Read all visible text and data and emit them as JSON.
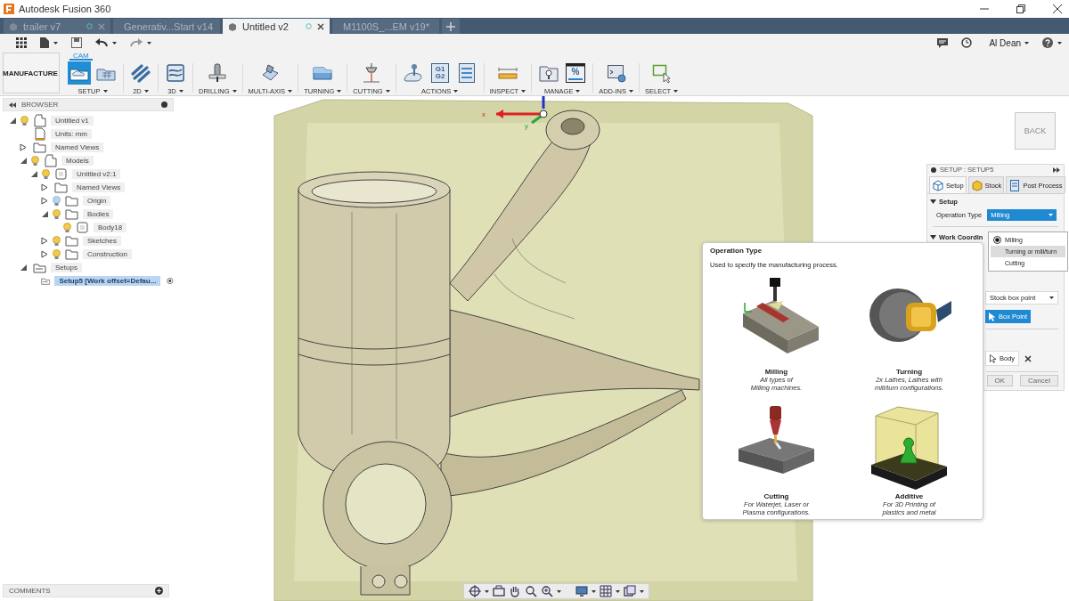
{
  "title_bar": {
    "app_title": "Autodesk Fusion 360"
  },
  "document_tabs": [
    {
      "label": "trailer v7",
      "selected": false
    },
    {
      "label": "Generativ...Start v14",
      "selected": false
    },
    {
      "label": "Untitled v2",
      "selected": true
    },
    {
      "label": "M1100S_...EM v19*",
      "selected": false
    }
  ],
  "user_menu": {
    "name": "Al Dean"
  },
  "ribbon": {
    "workspace": "MANUFACTURE",
    "tabs": [
      {
        "label": "CAM",
        "selected": true
      }
    ],
    "groups": [
      {
        "label": "SETUP",
        "tools": [
          {
            "kind": "setup",
            "selected": true
          },
          {
            "kind": "setup-sheet",
            "selected": false
          }
        ]
      },
      {
        "label": "2D",
        "tools": [
          {
            "kind": "pocket",
            "selected": false
          }
        ]
      },
      {
        "label": "3D",
        "tools": [
          {
            "kind": "surface",
            "selected": false
          }
        ]
      },
      {
        "label": "DRILLING",
        "tools": [
          {
            "kind": "drill",
            "selected": false
          }
        ]
      },
      {
        "label": "MULTI-AXIS",
        "tools": [
          {
            "kind": "multiaxis",
            "selected": false
          }
        ]
      },
      {
        "label": "TURNING",
        "tools": [
          {
            "kind": "turning",
            "selected": false
          }
        ]
      },
      {
        "label": "CUTTING",
        "tools": [
          {
            "kind": "cutting",
            "selected": false
          }
        ]
      },
      {
        "label": "ACTIONS",
        "tools": [
          {
            "kind": "simulate",
            "selected": false
          },
          {
            "kind": "gcode",
            "selected": false,
            "lines": [
              "G1",
              "G2"
            ]
          },
          {
            "kind": "sheet",
            "selected": false
          }
        ]
      },
      {
        "label": "INSPECT",
        "tools": [
          {
            "kind": "measure",
            "selected": false
          }
        ]
      },
      {
        "label": "MANAGE",
        "tools": [
          {
            "kind": "library",
            "selected": false
          },
          {
            "kind": "percent",
            "selected": false,
            "lines": [
              "%"
            ]
          }
        ]
      },
      {
        "label": "ADD-INS",
        "tools": [
          {
            "kind": "scripts",
            "selected": false
          }
        ]
      },
      {
        "label": "SELECT",
        "tools": [
          {
            "kind": "select",
            "selected": false
          }
        ]
      }
    ]
  },
  "browser": {
    "title": "BROWSER",
    "tree": [
      {
        "label": "Untitled v1",
        "kind": "component",
        "expanded": true,
        "visible": true,
        "selected": false,
        "children": [
          {
            "label": "Units: mm",
            "kind": "units",
            "selected": false
          },
          {
            "label": "Named Views",
            "kind": "folder",
            "expanded": false,
            "selected": false
          },
          {
            "label": "Models",
            "kind": "component",
            "expanded": true,
            "visible": true,
            "selected": false,
            "children": [
              {
                "label": "Untitled v2:1",
                "kind": "occurrence",
                "expanded": true,
                "visible": true,
                "selected": false,
                "children": [
                  {
                    "label": "Named Views",
                    "kind": "folder",
                    "expanded": false,
                    "selected": false
                  },
                  {
                    "label": "Origin",
                    "kind": "folder",
                    "expanded": false,
                    "visible": false,
                    "selected": false
                  },
                  {
                    "label": "Bodies",
                    "kind": "folder",
                    "expanded": true,
                    "visible": true,
                    "selected": false,
                    "children": [
                      {
                        "label": "Body18",
                        "kind": "body",
                        "visible": true,
                        "selected": false
                      }
                    ]
                  },
                  {
                    "label": "Sketches",
                    "kind": "folder",
                    "expanded": false,
                    "visible": true,
                    "selected": false
                  },
                  {
                    "label": "Construction",
                    "kind": "folder",
                    "expanded": false,
                    "visible": true,
                    "selected": false
                  }
                ]
              }
            ]
          },
          {
            "label": "Setups",
            "kind": "setups",
            "expanded": true,
            "selected": false,
            "children": [
              {
                "label": "Setup5 [Work offset=Defau...",
                "kind": "setup",
                "selected": true
              }
            ]
          }
        ]
      }
    ]
  },
  "viewport": {
    "view_cube": "BACK",
    "triad": {
      "x_label": "x",
      "y_label": "y"
    }
  },
  "setup_panel": {
    "title": "SETUP : SETUP5",
    "tabs": [
      {
        "label": "Setup",
        "kind": "setup",
        "selected": true
      },
      {
        "label": "Stock",
        "kind": "stock",
        "selected": false
      },
      {
        "label": "Post Process",
        "kind": "post",
        "selected": false
      }
    ],
    "section": {
      "label": "Setup",
      "expanded": true
    },
    "operation_type": {
      "label": "Operation Type",
      "value": "Milling",
      "expanded": true,
      "options": [
        {
          "label": "Milling",
          "checked": true,
          "highlighted": false
        },
        {
          "label": "Turning or mill/turn",
          "checked": false,
          "highlighted": true
        },
        {
          "label": "Cutting",
          "checked": false,
          "highlighted": false
        }
      ]
    },
    "work_section": {
      "label": "Work Coordin",
      "expanded": true
    },
    "origin_select": "Stock box point",
    "box_point_button": "Box Point",
    "body_button": "Body",
    "buttons": [
      {
        "label": "OK"
      },
      {
        "label": "Cancel"
      }
    ]
  },
  "tooltip": {
    "title": "Operation Type",
    "description": "Used to specify the manufacturing process.",
    "options": [
      {
        "kind": "milling",
        "title": "Milling",
        "description": "All types of\nMilling machines."
      },
      {
        "kind": "turning",
        "title": "Turning",
        "description": "2x Lathes, Lathes with\nmill/turn configurations."
      },
      {
        "kind": "cutting",
        "title": "Cutting",
        "description": "For Waterjet, Laser or\nPlasma configurations."
      },
      {
        "kind": "additive",
        "title": "Additive",
        "description": "For 3D Printing of\nplastics and metal"
      }
    ]
  },
  "comments": {
    "title": "COMMENTS"
  }
}
